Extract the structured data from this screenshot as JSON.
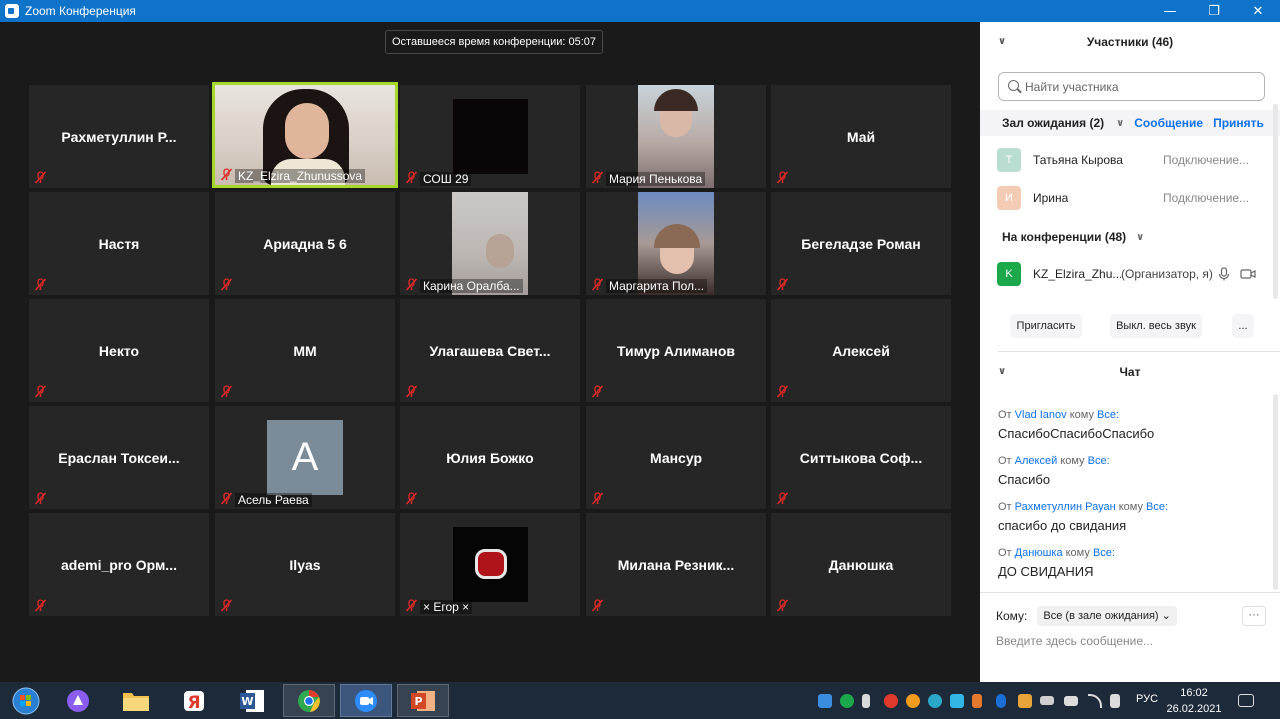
{
  "window": {
    "title": "Zoom Конференция",
    "minimize": "—",
    "restore": "❐",
    "close": "✕"
  },
  "timer": "Оставшееся время конференции: 05:07",
  "tiles": [
    {
      "name": "Рахметуллин  Р...",
      "label": ""
    },
    {
      "name": "",
      "label": "KZ_Elzira_Zhunussova"
    },
    {
      "name": "",
      "label": "СОШ 29"
    },
    {
      "name": "",
      "label": "Мария Пенькова"
    },
    {
      "name": "Май",
      "label": ""
    },
    {
      "name": "Настя",
      "label": ""
    },
    {
      "name": "Ариадна 5 6",
      "label": ""
    },
    {
      "name": "",
      "label": "Карина Оралба..."
    },
    {
      "name": "",
      "label": "Маргарита Пол..."
    },
    {
      "name": "Бегеладзе Роман",
      "label": ""
    },
    {
      "name": "Некто",
      "label": ""
    },
    {
      "name": "ММ",
      "label": ""
    },
    {
      "name": "Улагашева  Свет...",
      "label": ""
    },
    {
      "name": "Тимур Алиманов",
      "label": ""
    },
    {
      "name": "Алексей",
      "label": ""
    },
    {
      "name": "Ераслан  Токсеи...",
      "label": ""
    },
    {
      "name": "",
      "label": "Асель Раева",
      "avatar_letter": "A"
    },
    {
      "name": "Юлия Божко",
      "label": ""
    },
    {
      "name": "Мансур",
      "label": ""
    },
    {
      "name": "Ситтыкова  Соф...",
      "label": ""
    },
    {
      "name": "ademi_pro  Орм...",
      "label": ""
    },
    {
      "name": "Ilyas",
      "label": ""
    },
    {
      "name": "",
      "label": "× Егор ×"
    },
    {
      "name": "Милана  Резник...",
      "label": ""
    },
    {
      "name": "Данюшка",
      "label": ""
    }
  ],
  "participants": {
    "header": "Участники (46)",
    "search_placeholder": "Найти участника",
    "waiting": {
      "title": "Зал ожидания (2)",
      "message": "Сообщение",
      "admit": "Принять"
    },
    "waiting_people": [
      {
        "initial": "Т",
        "name": "Татьяна Кырова",
        "status": "Подключение...",
        "color": "#b9ddd0"
      },
      {
        "initial": "И",
        "name": "Ирина",
        "status": "Подключение...",
        "color": "#f4cbb4"
      }
    ],
    "in_conference": {
      "title": "На конференции (48)"
    },
    "in_people": [
      {
        "initial": "K",
        "name": "KZ_Elzira_Zhu...",
        "status": "(Организатор, я)",
        "color": "#1aa84a"
      }
    ],
    "invite": "Пригласить",
    "mute_all": "Выкл. весь звук",
    "more": "..."
  },
  "chat": {
    "header": "Чат",
    "from_word": "От",
    "to_word": "кому",
    "messages": [
      {
        "from": "Vlad Ianov",
        "to": "Все:",
        "text": "СпасибоСпасибоСпасибо"
      },
      {
        "from": "Алексей",
        "to": "Все:",
        "text": "Спасибо"
      },
      {
        "from": "Рахметуллин Рауан",
        "to": "Все:",
        "text": "спасибо до свидания"
      },
      {
        "from": "Данюшка",
        "to": "Все:",
        "text": "ДО СВИДАНИЯ"
      }
    ],
    "to_label": "Кому:",
    "to_value": "Все (в зале ожидания) ⌄",
    "more": "···",
    "input_placeholder": "Введите здесь сообщение..."
  },
  "taskbar": {
    "lang": "РУС",
    "time": "16:02",
    "date": "26.02.2021",
    "colors": {
      "start": "#2b7fd3",
      "alisa": "#8a5cf0",
      "folder": "#f2c14e",
      "yandex": "#e03a2c",
      "word": "#2b5797",
      "chrome": "#2fa84f",
      "zoom": "#2d8cff",
      "ppt": "#d24726"
    }
  }
}
